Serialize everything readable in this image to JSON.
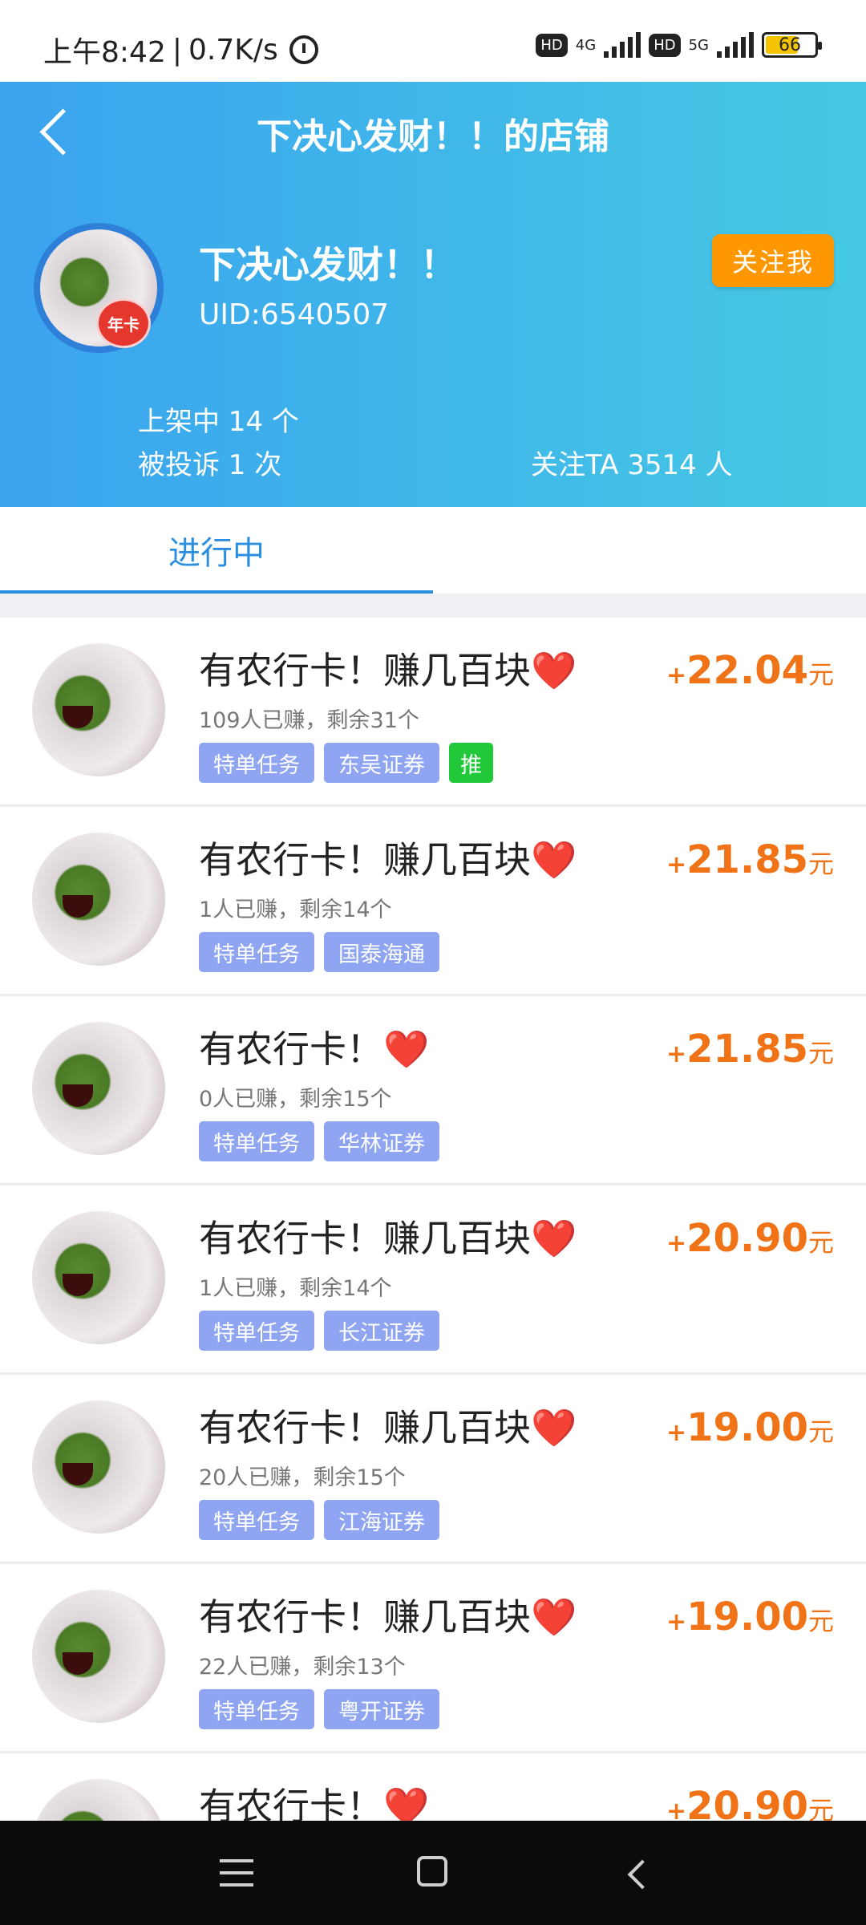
{
  "status_bar": {
    "time": "上午8:42",
    "speed": "0.7K/s",
    "hd1": "HD",
    "net1": "4G",
    "hd2": "HD",
    "net2": "5G",
    "battery": "66"
  },
  "header": {
    "nav_title": "下决心发财！！的店铺",
    "shop_name": "下决心发财！！",
    "uid": "UID:6540507",
    "badge": "年卡",
    "follow_label": "关注我",
    "stat_listed": "上架中 14 个",
    "stat_complaints": "被投诉 1 次",
    "stat_followers": "关注TA 3514 人"
  },
  "tabs": [
    {
      "label": "进行中",
      "active": true
    }
  ],
  "items": [
    {
      "title": "有农行卡！赚几百块",
      "heart": "❤️",
      "sub": "109人已赚，剩余31个",
      "tags": [
        "特单任务",
        "东吴证券"
      ],
      "rec": "推",
      "price": "22.04",
      "plus": "+",
      "unit": "元"
    },
    {
      "title": "有农行卡！赚几百块",
      "heart": "❤️",
      "sub": "1人已赚，剩余14个",
      "tags": [
        "特单任务",
        "国泰海通"
      ],
      "price": "21.85",
      "plus": "+",
      "unit": "元"
    },
    {
      "title": "有农行卡！",
      "heart": "❤️",
      "sub": "0人已赚，剩余15个",
      "tags": [
        "特单任务",
        "华林证券"
      ],
      "price": "21.85",
      "plus": "+",
      "unit": "元"
    },
    {
      "title": "有农行卡！赚几百块",
      "heart": "❤️",
      "sub": "1人已赚，剩余14个",
      "tags": [
        "特单任务",
        "长江证券"
      ],
      "price": "20.90",
      "plus": "+",
      "unit": "元"
    },
    {
      "title": "有农行卡！赚几百块",
      "heart": "❤️",
      "sub": "20人已赚，剩余15个",
      "tags": [
        "特单任务",
        "江海证券"
      ],
      "price": "19.00",
      "plus": "+",
      "unit": "元"
    },
    {
      "title": "有农行卡！赚几百块",
      "heart": "❤️",
      "sub": "22人已赚，剩余13个",
      "tags": [
        "特单任务",
        "粤开证券"
      ],
      "price": "19.00",
      "plus": "+",
      "unit": "元"
    },
    {
      "title": "有农行卡！",
      "heart": "❤️",
      "sub": "",
      "tags": [],
      "price": "20.90",
      "plus": "+",
      "unit": "元"
    }
  ],
  "colors": {
    "header_start": "#3aa3ee",
    "header_end": "#45c9e4",
    "follow_button": "#ff9800",
    "price": "#f07318",
    "tag": "#8fa5f2",
    "recommend_tag": "#21c93a",
    "tab_active": "#2b8fe0"
  },
  "icons": {
    "back": "back-arrow-icon",
    "alarm": "alarm-icon",
    "menu": "menu-icon",
    "home": "home-icon",
    "nav_back": "nav-back-icon"
  }
}
